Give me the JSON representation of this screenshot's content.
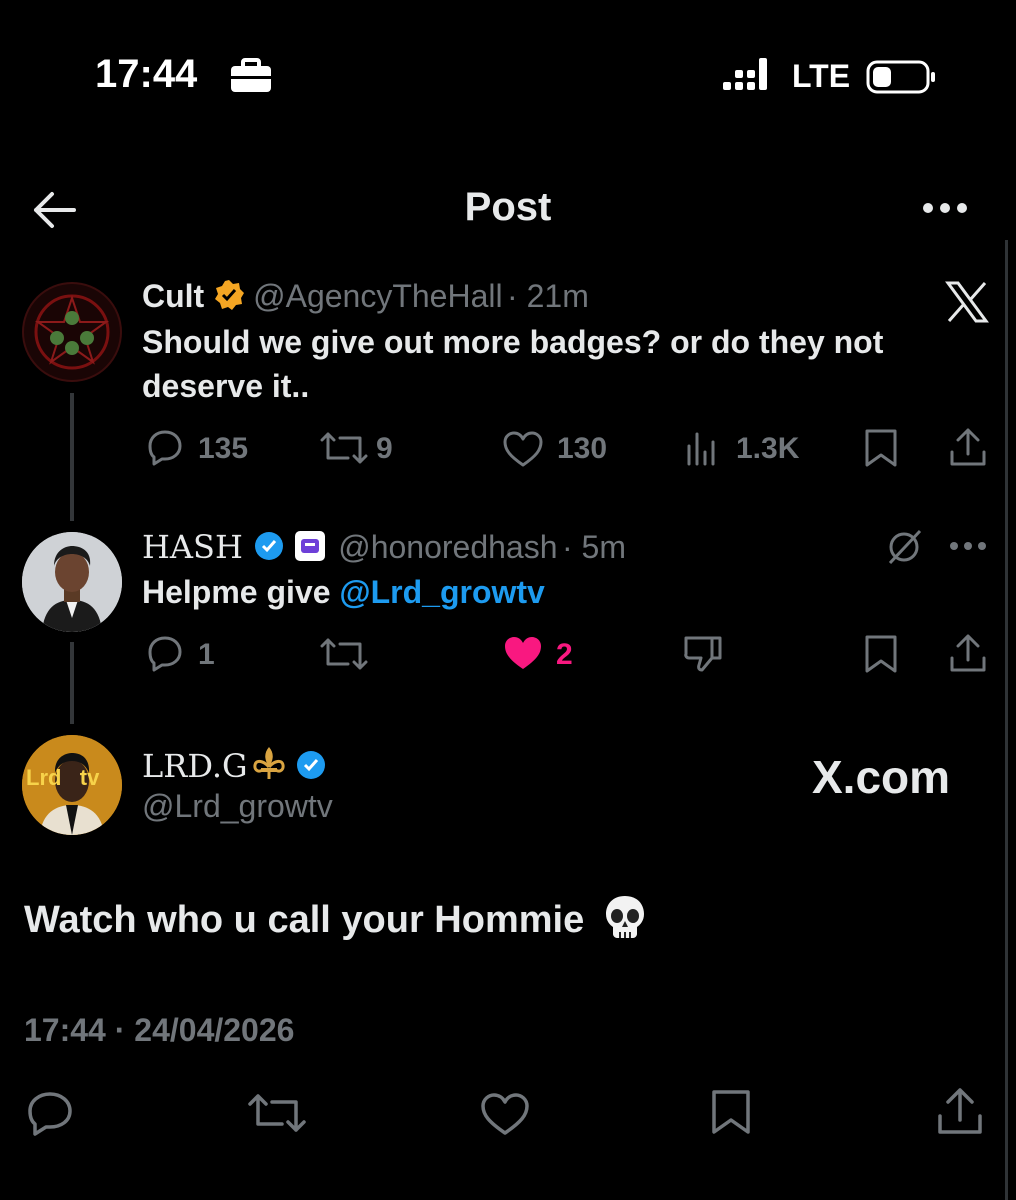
{
  "status_bar": {
    "time": "17:44",
    "network": "LTE"
  },
  "header": {
    "title": "Post"
  },
  "tweets": [
    {
      "name": "Cult",
      "handle": "@AgencyTheHall",
      "time": "· 21m",
      "text": "Should we give out more badges? or do they not deserve it..",
      "replies": "135",
      "retweets": "9",
      "likes": "130",
      "views": "1.3K"
    },
    {
      "name": "HASH",
      "handle": "@honoredhash",
      "time": "· 5m",
      "text_prefix": "Helpme give ",
      "mention": "@Lrd_growtv",
      "replies": "1",
      "likes": "2"
    }
  ],
  "main_post": {
    "name": "LRD.G",
    "handle": "@Lrd_growtv",
    "avatar_text": "Lrd   tv",
    "watermark": "X.com",
    "text": "Watch who u call your Hommie",
    "timestamp": "17:44 · 24/04/2026"
  },
  "colors": {
    "accent": "#1d9bf0",
    "like": "#f91880",
    "gold": "#f5a623",
    "muted": "#71767b"
  }
}
